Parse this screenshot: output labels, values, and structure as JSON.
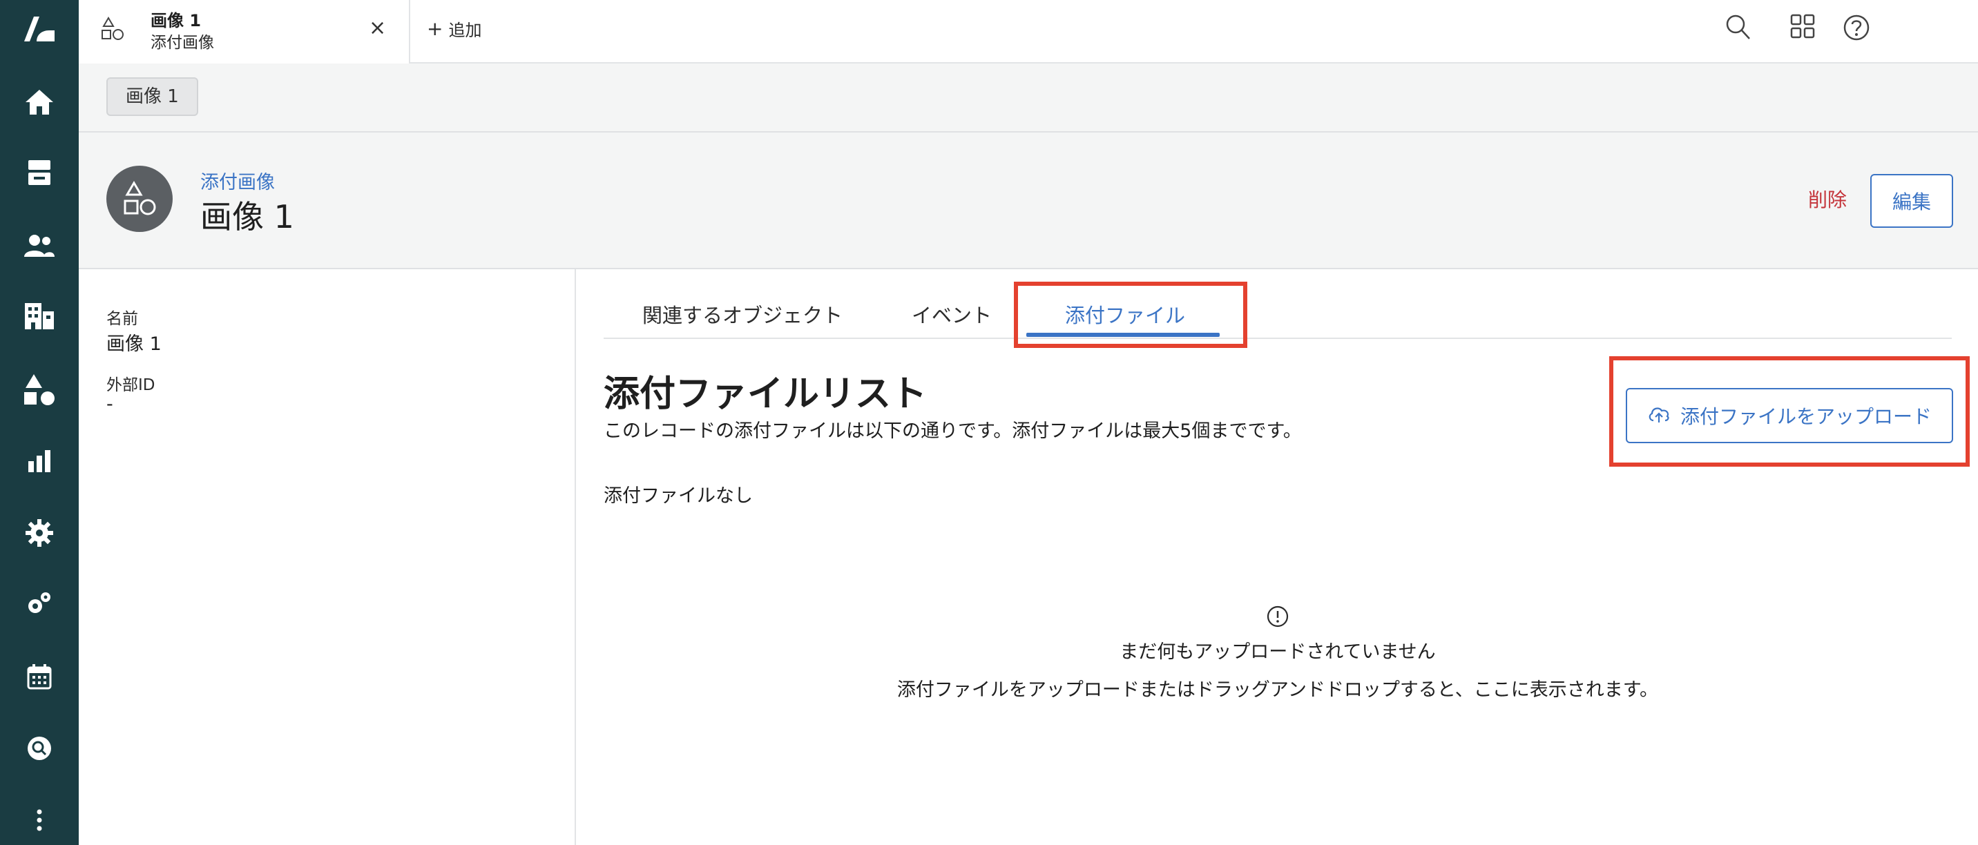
{
  "sidebar": {
    "items": [
      {
        "icon": "app-logo-icon"
      },
      {
        "icon": "home-icon"
      },
      {
        "icon": "inbox-icon"
      },
      {
        "icon": "people-icon"
      },
      {
        "icon": "building-icon"
      },
      {
        "icon": "shapes-icon"
      },
      {
        "icon": "bar-chart-icon"
      },
      {
        "icon": "gear-icon"
      },
      {
        "icon": "gears-icon"
      },
      {
        "icon": "calendar-icon"
      },
      {
        "icon": "search-circle-icon"
      },
      {
        "icon": "more-vertical-icon"
      }
    ],
    "bg_color": "#1a3c42"
  },
  "topbar": {
    "record_tab": {
      "title": "画像 1",
      "subtitle": "添付画像",
      "close": "×"
    },
    "add_tab": {
      "plus": "+",
      "label": "追加"
    },
    "icons": [
      "search-icon",
      "apps-grid-icon",
      "help-icon"
    ]
  },
  "breadcrumb": {
    "label": "画像 1"
  },
  "record": {
    "type_label": "添付画像",
    "title": "画像 1",
    "delete_label": "削除",
    "edit_label": "編集"
  },
  "fields": [
    {
      "label": "名前",
      "value": "画像 1"
    },
    {
      "label": "外部ID",
      "value": "-"
    }
  ],
  "tabs": [
    {
      "label": "関連するオブジェクト",
      "active": false
    },
    {
      "label": "イベント",
      "active": false
    },
    {
      "label": "添付ファイル",
      "active": true
    }
  ],
  "attachments": {
    "title": "添付ファイルリスト",
    "description": "このレコードの添付ファイルは以下の通りです。添付ファイルは最大5個までです。",
    "upload_label": "添付ファイルをアップロード",
    "none_label": "添付ファイルなし",
    "empty_line1": "まだ何もアップロードされていません",
    "empty_line2": "添付ファイルをアップロードまたはドラッグアンドドロップすると、ここに表示されます。"
  },
  "colors": {
    "accent": "#3b74c5",
    "danger": "#c4343a",
    "highlight": "#e4412f"
  }
}
